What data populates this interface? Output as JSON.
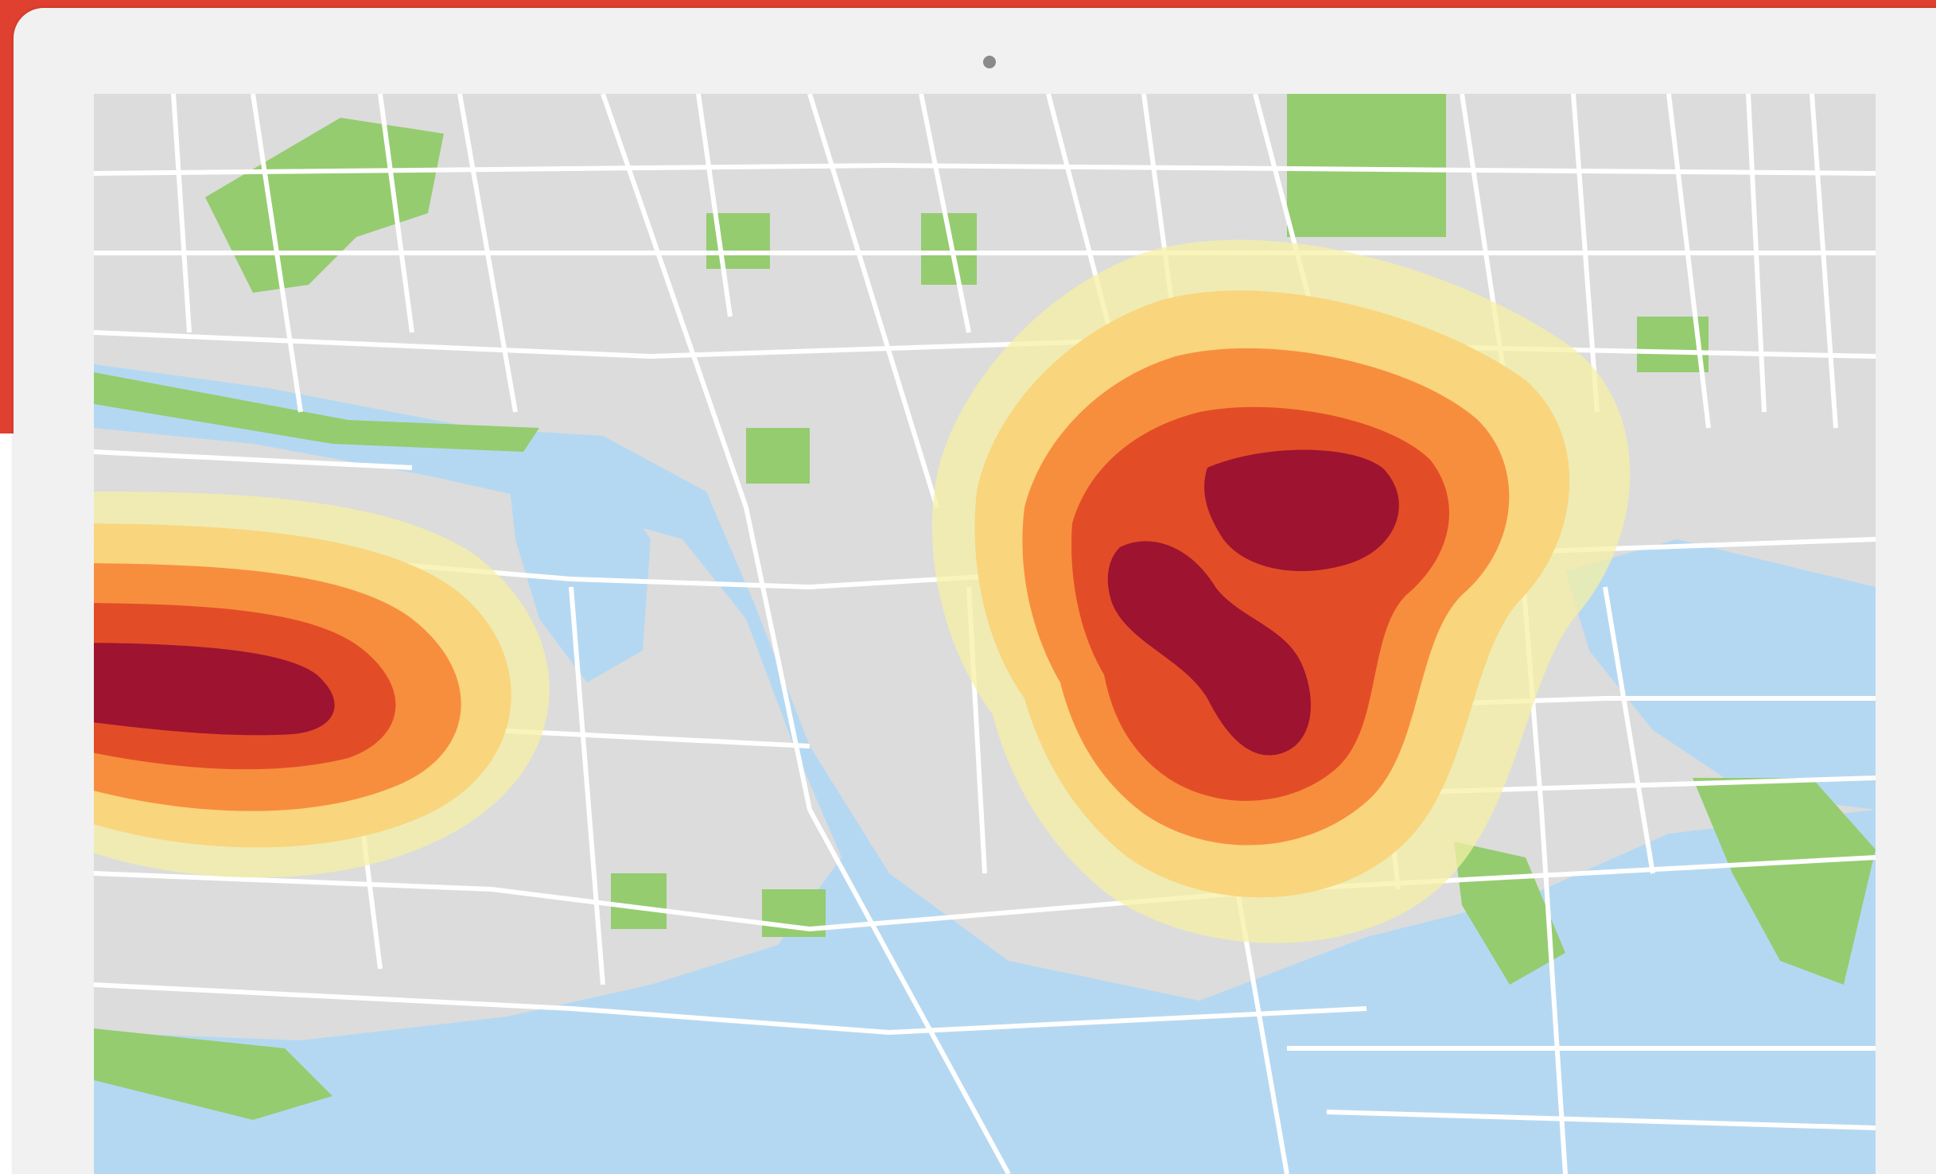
{
  "accent_color": "#e0402f",
  "device": {
    "frame_color": "#f1f1f1",
    "camera_color": "#8a8a8a"
  },
  "map": {
    "colors": {
      "land": "#dcdcdc",
      "roads": "#ffffff",
      "water": "#b5d8f2",
      "parks": "#95cc70"
    },
    "heat_scale": {
      "levels": [
        "lowest",
        "low",
        "medium",
        "high",
        "highest"
      ],
      "colors": [
        "#f6f0a6",
        "#f9d47a",
        "#f78a3b",
        "#e04a26",
        "#9a1030"
      ]
    },
    "hotspots": [
      {
        "id": "west-cluster",
        "intensity": "highest"
      },
      {
        "id": "center-cluster",
        "intensity": "highest"
      }
    ]
  }
}
